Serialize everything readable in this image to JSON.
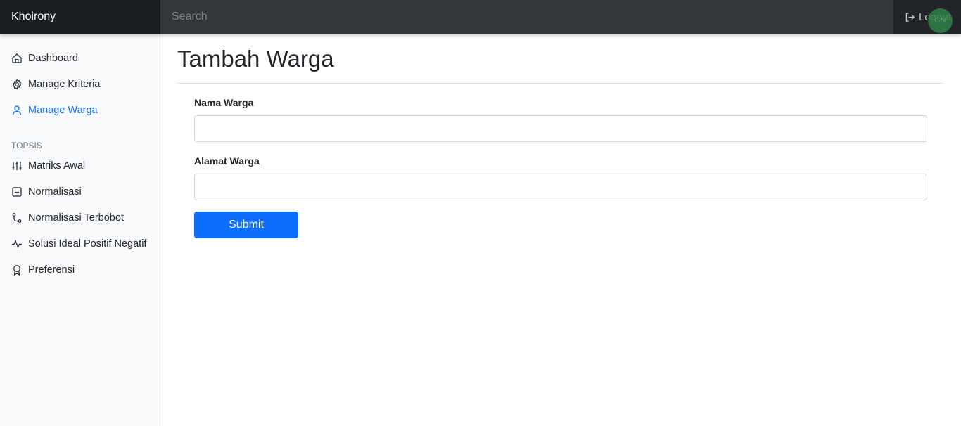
{
  "navbar": {
    "brand": "Khoirony",
    "search_placeholder": "Search",
    "logout_label": "Logout",
    "avatar_initials": "CN"
  },
  "sidebar": {
    "items": [
      {
        "label": "Dashboard",
        "icon": "home-icon"
      },
      {
        "label": "Manage Kriteria",
        "icon": "gear-icon"
      },
      {
        "label": "Manage Warga",
        "icon": "user-icon",
        "active": true
      }
    ],
    "section_heading": "TOPSIS",
    "topsis_items": [
      {
        "label": "Matriks Awal",
        "icon": "sliders-icon"
      },
      {
        "label": "Normalisasi",
        "icon": "minus-square-icon"
      },
      {
        "label": "Normalisasi Terbobot",
        "icon": "git-commit-icon"
      },
      {
        "label": "Solusi Ideal Positif Negatif",
        "icon": "activity-icon"
      },
      {
        "label": "Preferensi",
        "icon": "award-icon"
      }
    ]
  },
  "main": {
    "title": "Tambah Warga",
    "form": {
      "nama_label": "Nama Warga",
      "nama_value": "",
      "alamat_label": "Alamat Warga",
      "alamat_value": "",
      "submit_label": "Submit"
    }
  },
  "colors": {
    "accent": "#0d6efd",
    "navbar": "#212529",
    "sidebar": "#f8f9fa"
  }
}
